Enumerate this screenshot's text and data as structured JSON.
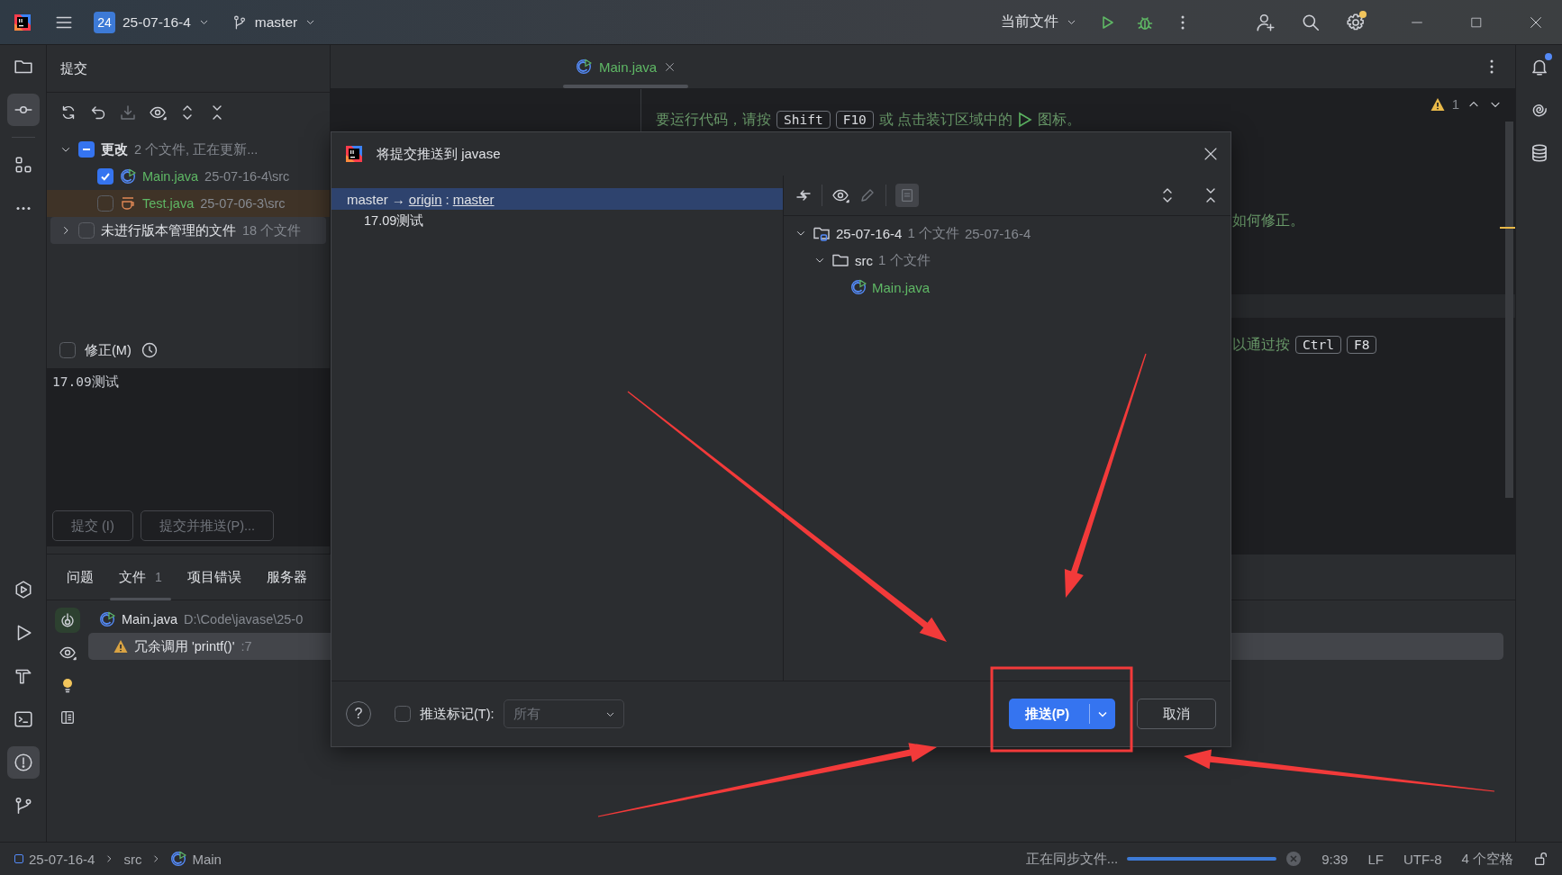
{
  "title_bar": {
    "project_badge": "24",
    "project": "25-07-16-4",
    "branch": "master",
    "run_config": "当前文件",
    "settings_badge": true
  },
  "left_tools": [
    {
      "kind": "folder",
      "selected": false
    },
    {
      "kind": "commit",
      "selected": true
    },
    {
      "kind": "structure",
      "selected": false
    },
    {
      "kind": "more",
      "selected": false
    }
  ],
  "left_tools_bottom": [
    {
      "kind": "services",
      "selected": false
    },
    {
      "kind": "run",
      "selected": false
    },
    {
      "kind": "build",
      "selected": false
    },
    {
      "kind": "terminal",
      "selected": false
    },
    {
      "kind": "problems",
      "selected": true
    },
    {
      "kind": "git",
      "selected": false
    }
  ],
  "commit_panel": {
    "title": "提交",
    "changes": {
      "label": "更改",
      "info": "2 个文件, 正在更新...",
      "expanded": true,
      "partial": true,
      "files": [
        {
          "name": "Main.java",
          "path": "25-07-16-4\\src",
          "kind": "class",
          "checked": true,
          "selected": false
        },
        {
          "name": "Test.java",
          "path": "25-07-06-3\\src",
          "kind": "test",
          "checked": false,
          "selected": true
        }
      ]
    },
    "unversioned": {
      "label": "未进行版本管理的文件",
      "info": "18 个文件",
      "expanded": false,
      "checked": false
    },
    "amend": {
      "label": "修正(M)",
      "checked": false
    },
    "message": "17.09测试",
    "buttons": [
      {
        "label": "提交 (I)",
        "disabled": true
      },
      {
        "label": "提交并推送(P)...",
        "disabled": true
      }
    ]
  },
  "editor": {
    "tabs": [
      {
        "label": "Main.java",
        "selected": true
      }
    ],
    "warnings": "1",
    "lines": [
      {
        "after_dialog": false,
        "parts": [
          {
            "kind": "text",
            "text": "要运行代码，请按"
          },
          {
            "kind": "key",
            "text": "Shift"
          },
          {
            "kind": "key",
            "text": "F10"
          },
          {
            "kind": "text",
            "text": "或 点击装订区域中的"
          },
          {
            "kind": "run_icon"
          },
          {
            "kind": "text",
            "text": "图标。"
          }
        ]
      },
      {
        "after_dialog": true,
        "parts": [
          {
            "kind": "text",
            "text": "如何修正。"
          }
        ]
      },
      {
        "after_dialog": true,
        "parts": [
          {
            "kind": "text",
            "text": "以通过按"
          },
          {
            "kind": "key",
            "text": "Ctrl"
          },
          {
            "kind": "key",
            "text": "F8"
          }
        ]
      }
    ]
  },
  "problems_panel": {
    "tabs": [
      {
        "label": "问题",
        "selected": false
      },
      {
        "label": "文件",
        "count": "1",
        "selected": true
      },
      {
        "label": "项目错误",
        "selected": false
      },
      {
        "label": "服务器",
        "selected": false
      }
    ],
    "file": {
      "name": "Main.java",
      "path": "D:\\Code\\javase\\25-0"
    },
    "issues": [
      {
        "text": "冗余调用 'printf()'",
        "line": ":7",
        "selected": true
      }
    ]
  },
  "push_dialog": {
    "title": "将提交推送到 javase",
    "branch": {
      "local": "master",
      "arrow": "→",
      "remote": "origin",
      "sep": ":",
      "target": "master",
      "selected": true
    },
    "commits": [
      "17.09测试"
    ],
    "tree": [
      {
        "kind": "module",
        "name": "25-07-16-4",
        "info": "1 个文件",
        "extra": "25-07-16-4",
        "expanded": true,
        "children": [
          {
            "kind": "folder",
            "name": "src",
            "info": "1 个文件",
            "expanded": true,
            "children": [
              {
                "kind": "class",
                "name": "Main.java"
              }
            ]
          }
        ]
      }
    ],
    "help": "?",
    "push_tags": {
      "label": "推送标记(T):",
      "checked": false
    },
    "tags_dropdown": {
      "value": "所有",
      "disabled": true
    },
    "push_button": "推送(P)",
    "cancel_button": "取消"
  },
  "status_bar": {
    "breadcrumbs": [
      "25-07-16-4",
      "src",
      "Main"
    ],
    "task": "正在同步文件...",
    "level": 1,
    "items": [
      "9:39",
      "LF",
      "UTF-8",
      "4 个空格"
    ]
  }
}
